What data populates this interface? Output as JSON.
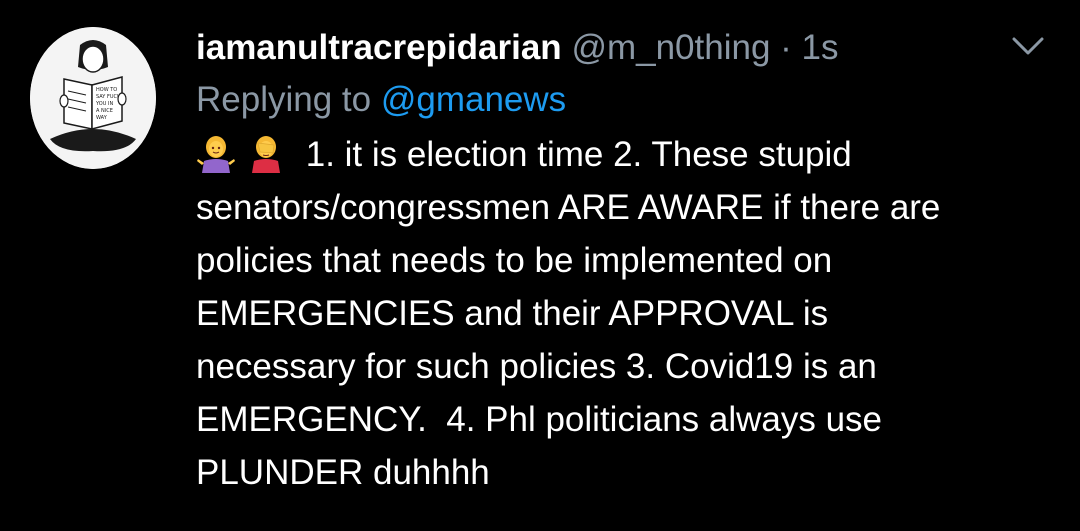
{
  "tweet": {
    "display_name": "iamanultracrepidarian",
    "handle": "@m_n0thing",
    "separator": "·",
    "timestamp": "1s",
    "replying_prefix": "Replying to",
    "replying_to": "@gmanews",
    "emojis": [
      "person-shrugging-emoji",
      "person-facepalming-emoji"
    ],
    "body_lines": [
      " 1. it is election time 2. These stupid",
      "senators/congressmen ARE AWARE if there are",
      "policies that needs to be implemented on",
      "EMERGENCIES and their APPROVAL is",
      "necessary for such policies 3. Covid19 is an",
      "EMERGENCY.  4. Phl politicians always use",
      "PLUNDER duhhhh"
    ],
    "avatar_text": "HOW TO SAY FUCK YOU IN A NICE WAY"
  },
  "colors": {
    "background": "#000000",
    "name": "#ffffff",
    "secondary": "#8b98a5",
    "accent": "#1d9bf0",
    "body": "#ffffff"
  },
  "icons": {
    "more": "chevron-down-icon"
  }
}
